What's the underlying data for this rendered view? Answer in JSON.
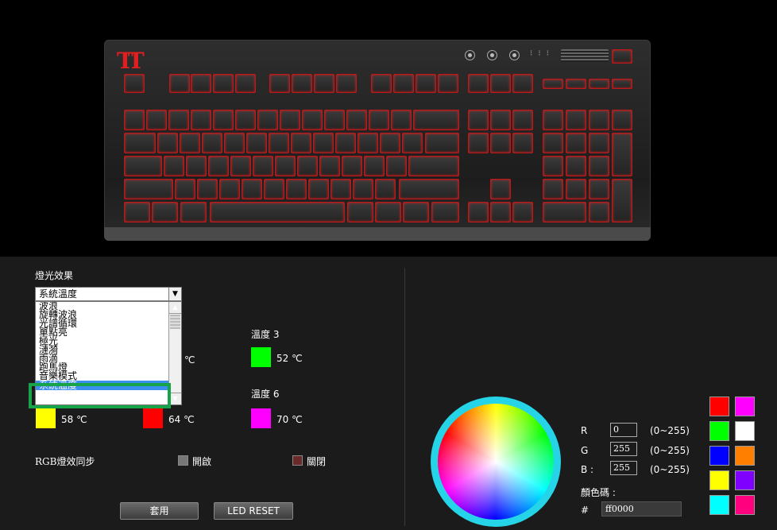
{
  "lighting": {
    "section_title": "燈光效果",
    "selected_effect": "系統溫度",
    "options": [
      "波浪",
      "旋轉波浪",
      "光譜循環",
      "單點亮",
      "極光",
      "漣漪",
      "雨滴",
      "跑馬燈",
      "音樂模式",
      "系統溫度"
    ],
    "temperature_labels": {
      "t3": "溫度 3",
      "t6": "溫度 6"
    },
    "temps": {
      "partial": "℃",
      "t3_value": "52 ℃",
      "t4_value": "58 ℃",
      "t5_value": "64 ℃",
      "t6_value": "70 ℃"
    },
    "temp_colors": {
      "t3": "#00ff00",
      "t4": "#ffff00",
      "t5": "#ff0000",
      "t6": "#ff00ff"
    }
  },
  "rgb_sync": {
    "label": "RGB燈效同步",
    "on_label": "開啟",
    "off_label": "關閉"
  },
  "buttons": {
    "apply": "套用",
    "led_reset": "LED RESET"
  },
  "color_picker": {
    "r_label": "R",
    "g_label": "G",
    "b_label": "B :",
    "r_value": "0",
    "g_value": "255",
    "b_value": "255",
    "range": "(0~255)",
    "code_label": "顏色碼 :",
    "hash": "#",
    "hex_value": "ff0000",
    "ring_color": "#25d4e6"
  },
  "palette": [
    "#ff0000",
    "#ff00ff",
    "#00ff00",
    "#ffffff",
    "#0000ff",
    "#ff7f00",
    "#ffff00",
    "#7f00ff",
    "#00ffff",
    "#ff007f"
  ]
}
